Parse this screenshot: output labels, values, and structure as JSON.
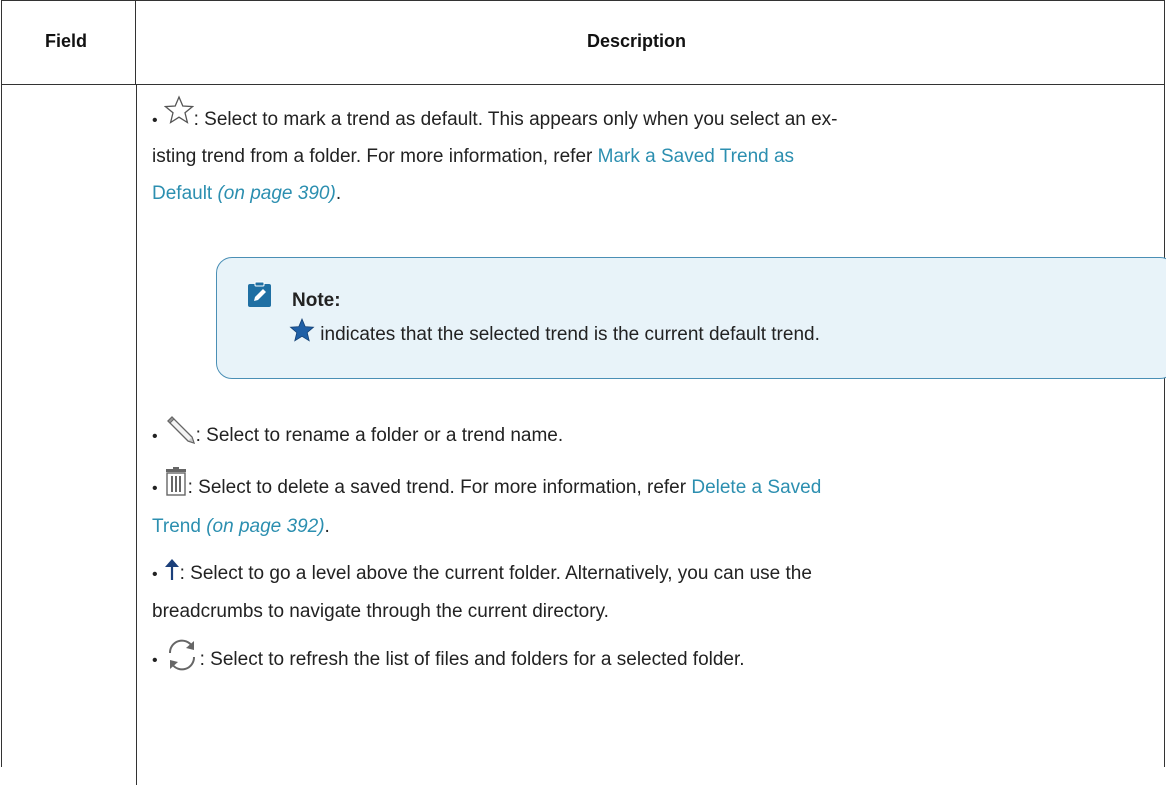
{
  "table": {
    "header": {
      "field": "Field",
      "description": "Description"
    }
  },
  "items": {
    "star": {
      "icon": "star-outline-icon",
      "line1": ": Select to mark a trend as default. This appears only when you select an ex-",
      "line2_text": "isting trend from a folder. For more information, refer ",
      "line2_link": "Mark a Saved Trend as",
      "line3_link": "Default",
      "line3_page": "(on page 390)",
      "line3_end": "."
    },
    "note": {
      "icon": "pencil-note-icon",
      "title": "Note:",
      "star_icon": "star-filled-icon",
      "body": " indicates that the selected trend is the current default trend."
    },
    "rename": {
      "icon": "pencil-icon",
      "text": ": Select to rename a folder or a trend name."
    },
    "delete": {
      "icon": "trash-icon",
      "line1_text": ": Select to delete a saved trend. For more information, refer ",
      "line1_link": "Delete a Saved",
      "line2_link": "Trend",
      "line2_page": "(on page 392)",
      "line2_end": "."
    },
    "up": {
      "icon": "arrow-up-icon",
      "line1": ": Select to go a level above the current folder. Alternatively, you can use the",
      "line2": "breadcrumbs to navigate through the current directory."
    },
    "refresh": {
      "icon": "refresh-icon",
      "text": ": Select to refresh the list of files and folders for a selected folder."
    }
  },
  "colors": {
    "link": "#2c8fb0",
    "note_bg": "#e8f3f9",
    "note_border": "#4a8fb5",
    "star": "#1f5fa6"
  }
}
